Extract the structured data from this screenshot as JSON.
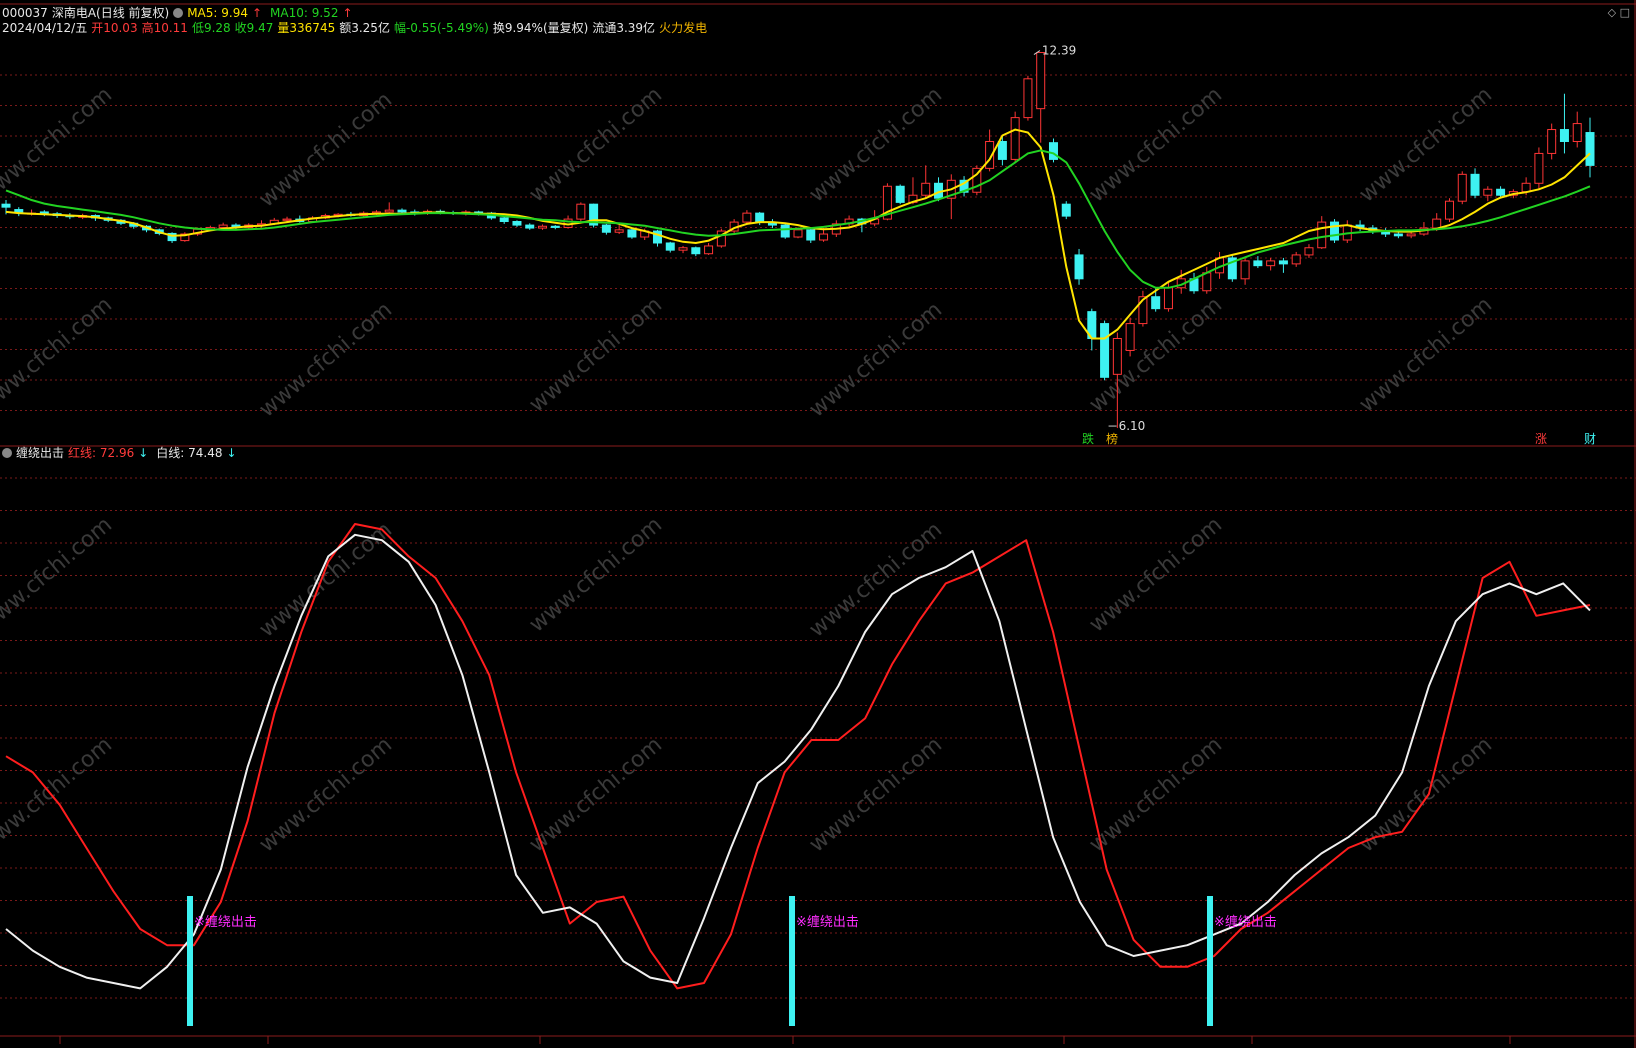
{
  "header": {
    "stock_code": "000037",
    "stock_name": "深南电A(日线 前复权)",
    "ma5_label": "MA5: 9.94",
    "ma10_label": "MA10: 9.52",
    "arrow_up": "↑",
    "date": "2024/04/12/五",
    "open": "开10.03",
    "high": "高10.11",
    "low": "低9.28",
    "close": "收9.47",
    "volume": "量336745",
    "amount": "额3.25亿",
    "change": "幅-0.55(-5.49%)",
    "turnover": "换9.94%(量复权)",
    "float_cap": "流通3.39亿",
    "concept": "火力发电"
  },
  "icons": {
    "indicator_toggle": "circle-icon",
    "window_controls": "◇ □"
  },
  "indicator_header": {
    "name": "缠绕出击",
    "red_line": "红线: 72.96",
    "white_line": "白线: 74.48",
    "arrow_down": "↓"
  },
  "colors": {
    "background": "#000000",
    "up": "#ff3535",
    "down": "#3ef2f2",
    "ma5": "#ffe400",
    "ma10": "#22d322",
    "grid": "#7a1a1a",
    "signal": "#3ef2f2",
    "signal_text": "#ff2dff",
    "red_line": "#ff1e1e",
    "white_line": "#f0f0f0",
    "watermark": "#3a3a3a"
  },
  "watermark": "www.cfchi.com",
  "annotations": {
    "high_value": "12.39",
    "low_value": "6.10",
    "tag_die": "跌",
    "tag_bang": "榜",
    "tag_zhang": "涨",
    "tag_cai": "财"
  },
  "signals": {
    "label": "※缠绕出击"
  },
  "chart_data": [
    {
      "type": "candlestick",
      "series": [
        {
          "name": "MA5",
          "values": [
            9.72,
            9.7,
            9.69,
            9.68,
            9.67,
            9.66,
            9.65,
            9.63,
            9.6,
            9.57,
            9.53,
            9.46,
            9.38,
            9.32,
            9.33,
            9.37,
            9.41,
            9.44,
            9.46,
            9.48,
            9.49,
            9.52,
            9.55,
            9.58,
            9.61,
            9.63,
            9.65,
            9.67,
            9.68,
            9.69,
            9.69,
            9.69,
            9.7,
            9.71,
            9.71,
            9.7,
            9.7,
            9.69,
            9.69,
            9.68,
            9.66,
            9.62,
            9.57,
            9.54,
            9.51,
            9.54,
            9.58,
            9.58,
            9.52,
            9.45,
            9.4,
            9.34,
            9.27,
            9.22,
            9.2,
            9.24,
            9.33,
            9.45,
            9.52,
            9.55,
            9.55,
            9.53,
            9.5,
            9.45,
            9.43,
            9.44,
            9.46,
            9.52,
            9.6,
            9.72,
            9.81,
            9.89,
            9.95,
            10.05,
            10.1,
            10.2,
            10.35,
            10.6,
            11.0,
            11.1,
            11.05,
            10.8,
            10.0,
            8.8,
            7.9,
            7.6,
            7.6,
            7.75,
            8.0,
            8.25,
            8.4,
            8.55,
            8.65,
            8.75,
            8.85,
            8.95,
            9.0,
            9.05,
            9.1,
            9.15,
            9.2,
            9.3,
            9.4,
            9.45,
            9.48,
            9.5,
            9.45,
            9.42,
            9.4,
            9.39,
            9.39,
            9.41,
            9.44,
            9.5,
            9.6,
            9.72,
            9.86,
            9.96,
            10.02,
            10.05,
            10.1,
            10.18,
            10.3,
            10.5,
            10.7
          ]
        },
        {
          "name": "MA10",
          "values": [
            10.08,
            10.0,
            9.92,
            9.86,
            9.82,
            9.79,
            9.76,
            9.73,
            9.7,
            9.67,
            9.63,
            9.58,
            9.53,
            9.49,
            9.46,
            9.44,
            9.43,
            9.42,
            9.42,
            9.43,
            9.44,
            9.46,
            9.49,
            9.52,
            9.55,
            9.57,
            9.59,
            9.61,
            9.63,
            9.65,
            9.67,
            9.68,
            9.69,
            9.7,
            9.7,
            9.7,
            9.69,
            9.68,
            9.67,
            9.65,
            9.63,
            9.61,
            9.59,
            9.58,
            9.56,
            9.55,
            9.55,
            9.54,
            9.53,
            9.51,
            9.49,
            9.45,
            9.41,
            9.37,
            9.34,
            9.32,
            9.33,
            9.35,
            9.38,
            9.41,
            9.42,
            9.43,
            9.44,
            9.45,
            9.47,
            9.5,
            9.53,
            9.57,
            9.62,
            9.68,
            9.74,
            9.8,
            9.86,
            9.93,
            10.0,
            10.07,
            10.15,
            10.25,
            10.4,
            10.55,
            10.7,
            10.75,
            10.7,
            10.55,
            10.2,
            9.8,
            9.4,
            9.05,
            8.75,
            8.55,
            8.45,
            8.45,
            8.5,
            8.6,
            8.7,
            8.8,
            8.88,
            8.96,
            9.04,
            9.1,
            9.16,
            9.21,
            9.26,
            9.3,
            9.33,
            9.36,
            9.38,
            9.39,
            9.4,
            9.41,
            9.41,
            9.42,
            9.43,
            9.45,
            9.48,
            9.52,
            9.57,
            9.63,
            9.7,
            9.77,
            9.84,
            9.91,
            9.98,
            10.06,
            10.15
          ]
        }
      ],
      "candles": [
        [
          9.85,
          9.8,
          9.92,
          9.68
        ],
        [
          9.76,
          9.72,
          9.8,
          9.65
        ],
        [
          9.7,
          9.7,
          9.76,
          9.66
        ],
        [
          9.72,
          9.69,
          9.75,
          9.65
        ],
        [
          9.69,
          9.66,
          9.72,
          9.62
        ],
        [
          9.66,
          9.64,
          9.7,
          9.6
        ],
        [
          9.63,
          9.66,
          9.69,
          9.6
        ],
        [
          9.66,
          9.62,
          9.68,
          9.57
        ],
        [
          9.62,
          9.58,
          9.64,
          9.55
        ],
        [
          9.58,
          9.53,
          9.6,
          9.5
        ],
        [
          9.53,
          9.48,
          9.55,
          9.44
        ],
        [
          9.48,
          9.42,
          9.5,
          9.38
        ],
        [
          9.42,
          9.36,
          9.44,
          9.33
        ],
        [
          9.36,
          9.24,
          9.38,
          9.2
        ],
        [
          9.24,
          9.35,
          9.38,
          9.22
        ],
        [
          9.35,
          9.43,
          9.46,
          9.32
        ],
        [
          9.43,
          9.46,
          9.49,
          9.4
        ],
        [
          9.46,
          9.5,
          9.54,
          9.44
        ],
        [
          9.5,
          9.46,
          9.53,
          9.42
        ],
        [
          9.46,
          9.5,
          9.53,
          9.44
        ],
        [
          9.5,
          9.52,
          9.58,
          9.46
        ],
        [
          9.52,
          9.58,
          9.62,
          9.5
        ],
        [
          9.58,
          9.6,
          9.64,
          9.55
        ],
        [
          9.6,
          9.56,
          9.66,
          9.54
        ],
        [
          9.56,
          9.62,
          9.65,
          9.54
        ],
        [
          9.62,
          9.66,
          9.69,
          9.6
        ],
        [
          9.66,
          9.68,
          9.7,
          9.63
        ],
        [
          9.68,
          9.66,
          9.72,
          9.64
        ],
        [
          9.66,
          9.7,
          9.73,
          9.64
        ],
        [
          9.7,
          9.72,
          9.75,
          9.67
        ],
        [
          9.72,
          9.75,
          9.88,
          9.7
        ],
        [
          9.75,
          9.72,
          9.78,
          9.69
        ],
        [
          9.72,
          9.7,
          9.76,
          9.66
        ],
        [
          9.7,
          9.73,
          9.76,
          9.67
        ],
        [
          9.73,
          9.71,
          9.76,
          9.68
        ],
        [
          9.71,
          9.7,
          9.74,
          9.67
        ],
        [
          9.7,
          9.72,
          9.75,
          9.66
        ],
        [
          9.72,
          9.7,
          9.74,
          9.66
        ],
        [
          9.7,
          9.62,
          9.72,
          9.59
        ],
        [
          9.62,
          9.56,
          9.64,
          9.52
        ],
        [
          9.56,
          9.5,
          9.58,
          9.47
        ],
        [
          9.5,
          9.45,
          9.53,
          9.42
        ],
        [
          9.45,
          9.48,
          9.51,
          9.42
        ],
        [
          9.48,
          9.46,
          9.5,
          9.43
        ],
        [
          9.46,
          9.6,
          9.66,
          9.44
        ],
        [
          9.6,
          9.85,
          9.88,
          9.55
        ],
        [
          9.85,
          9.5,
          9.86,
          9.46
        ],
        [
          9.5,
          9.38,
          9.52,
          9.34
        ],
        [
          9.38,
          9.42,
          9.5,
          9.35
        ],
        [
          9.42,
          9.3,
          9.45,
          9.27
        ],
        [
          9.3,
          9.4,
          9.44,
          9.25
        ],
        [
          9.4,
          9.2,
          9.42,
          9.14
        ],
        [
          9.2,
          9.08,
          9.22,
          9.04
        ],
        [
          9.08,
          9.12,
          9.15,
          9.03
        ],
        [
          9.12,
          9.02,
          9.14,
          8.98
        ],
        [
          9.02,
          9.15,
          9.2,
          9.0
        ],
        [
          9.15,
          9.4,
          9.44,
          9.12
        ],
        [
          9.4,
          9.55,
          9.6,
          9.35
        ],
        [
          9.55,
          9.7,
          9.75,
          9.5
        ],
        [
          9.7,
          9.55,
          9.72,
          9.5
        ],
        [
          9.55,
          9.5,
          9.6,
          9.45
        ],
        [
          9.5,
          9.3,
          9.52,
          9.27
        ],
        [
          9.3,
          9.42,
          9.46,
          9.28
        ],
        [
          9.42,
          9.25,
          9.45,
          9.2
        ],
        [
          9.25,
          9.35,
          9.45,
          9.22
        ],
        [
          9.35,
          9.52,
          9.58,
          9.3
        ],
        [
          9.52,
          9.6,
          9.66,
          9.48
        ],
        [
          9.6,
          9.52,
          9.62,
          9.38
        ],
        [
          9.52,
          9.6,
          9.75,
          9.48
        ],
        [
          9.6,
          10.15,
          10.2,
          9.58
        ],
        [
          10.15,
          9.88,
          10.18,
          9.85
        ],
        [
          9.88,
          10.0,
          10.3,
          9.85
        ],
        [
          10.0,
          10.2,
          10.5,
          9.95
        ],
        [
          10.2,
          9.95,
          10.3,
          9.9
        ],
        [
          9.95,
          10.25,
          10.35,
          9.6
        ],
        [
          10.25,
          10.05,
          10.32,
          9.98
        ],
        [
          10.05,
          10.45,
          10.5,
          10.0
        ],
        [
          10.45,
          10.9,
          11.1,
          10.4
        ],
        [
          10.9,
          10.6,
          11.0,
          10.5
        ],
        [
          10.6,
          11.3,
          11.4,
          10.55
        ],
        [
          11.3,
          11.95,
          12.0,
          11.25
        ],
        [
          11.45,
          12.39,
          12.39,
          10.88
        ],
        [
          10.88,
          10.6,
          10.95,
          10.55
        ],
        [
          9.85,
          9.65,
          9.9,
          9.6
        ],
        [
          9.0,
          8.6,
          9.1,
          8.5
        ],
        [
          8.05,
          7.6,
          8.1,
          7.4
        ],
        [
          7.85,
          6.95,
          7.9,
          6.9
        ],
        [
          7.0,
          7.6,
          7.7,
          6.1
        ],
        [
          7.4,
          7.85,
          7.95,
          7.3
        ],
        [
          7.85,
          8.3,
          8.4,
          7.8
        ],
        [
          8.3,
          8.1,
          8.45,
          8.05
        ],
        [
          8.1,
          8.45,
          8.55,
          8.05
        ],
        [
          8.45,
          8.6,
          8.75,
          8.35
        ],
        [
          8.6,
          8.4,
          8.7,
          8.35
        ],
        [
          8.4,
          8.7,
          8.8,
          8.35
        ],
        [
          8.7,
          8.95,
          9.05,
          8.6
        ],
        [
          8.95,
          8.6,
          9.0,
          8.55
        ],
        [
          8.6,
          8.9,
          8.95,
          8.5
        ],
        [
          8.9,
          8.82,
          8.98,
          8.78
        ],
        [
          8.82,
          8.9,
          8.95,
          8.74
        ],
        [
          8.9,
          8.85,
          8.95,
          8.7
        ],
        [
          8.85,
          9.0,
          9.05,
          8.8
        ],
        [
          9.0,
          9.12,
          9.18,
          8.95
        ],
        [
          9.12,
          9.55,
          9.65,
          9.1
        ],
        [
          9.55,
          9.25,
          9.6,
          9.2
        ],
        [
          9.25,
          9.5,
          9.58,
          9.2
        ],
        [
          9.5,
          9.45,
          9.58,
          9.4
        ],
        [
          9.45,
          9.4,
          9.5,
          9.35
        ],
        [
          9.4,
          9.35,
          9.45,
          9.3
        ],
        [
          9.35,
          9.32,
          9.4,
          9.28
        ],
        [
          9.32,
          9.35,
          9.42,
          9.28
        ],
        [
          9.35,
          9.45,
          9.55,
          9.32
        ],
        [
          9.45,
          9.6,
          9.7,
          9.4
        ],
        [
          9.6,
          9.9,
          9.95,
          9.55
        ],
        [
          9.9,
          10.35,
          10.4,
          9.85
        ],
        [
          10.35,
          10.0,
          10.45,
          9.95
        ],
        [
          10.0,
          10.1,
          10.15,
          9.9
        ],
        [
          10.1,
          10.0,
          10.15,
          9.95
        ],
        [
          10.0,
          10.06,
          10.1,
          9.95
        ],
        [
          10.06,
          10.2,
          10.3,
          10.0
        ],
        [
          10.2,
          10.7,
          10.8,
          10.1
        ],
        [
          10.7,
          11.1,
          11.2,
          10.6
        ],
        [
          11.1,
          10.9,
          11.7,
          10.7
        ],
        [
          10.9,
          11.2,
          11.4,
          10.8
        ],
        [
          11.05,
          10.5,
          11.3,
          10.3
        ]
      ]
    },
    {
      "type": "line",
      "series": [
        {
          "name": "红线",
          "values": [
            47,
            44,
            38,
            30,
            22,
            15,
            12,
            12,
            20,
            35,
            55,
            70,
            83,
            90,
            89,
            84,
            80,
            72,
            62,
            44,
            30,
            16,
            20,
            21,
            11,
            4,
            5,
            14,
            30,
            44,
            50,
            50,
            54,
            64,
            72,
            79,
            81,
            84,
            87,
            70,
            48,
            26,
            13,
            8,
            8,
            10,
            15,
            18,
            22,
            26,
            30,
            32,
            33,
            40,
            60,
            80,
            83,
            73,
            74,
            75
          ]
        },
        {
          "name": "白线",
          "values": [
            15,
            11,
            8,
            6,
            5,
            4,
            8,
            14,
            26,
            45,
            60,
            73,
            84,
            88,
            87,
            83,
            75,
            62,
            44,
            25,
            18,
            19,
            16,
            9,
            6,
            5,
            17,
            30,
            42,
            46,
            52,
            60,
            70,
            77,
            80,
            82,
            85,
            72,
            52,
            32,
            20,
            12,
            10,
            11,
            12,
            14,
            16,
            20,
            25,
            29,
            32,
            36,
            44,
            60,
            72,
            77,
            79,
            77,
            79,
            74
          ]
        }
      ]
    }
  ]
}
